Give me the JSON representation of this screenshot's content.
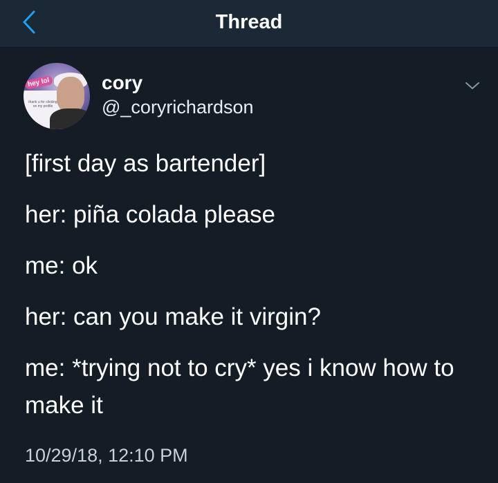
{
  "header": {
    "title": "Thread"
  },
  "tweet": {
    "author_name": "cory",
    "author_handle": "@_coryrichardson",
    "avatar_sticker": "hey lol",
    "avatar_card_text": "thank u for clicking on my profile",
    "lines": [
      "[first day as bartender]",
      "her: piña colada please",
      "me: ok",
      "her: can you make it virgin?",
      "me: *trying not to cry* yes i know how to make it"
    ],
    "timestamp": "10/29/18, 12:10 PM"
  },
  "colors": {
    "background": "#141d26",
    "header_background": "#1b2836",
    "accent": "#1da1f2"
  },
  "icons": {
    "back": "chevron-left-icon",
    "menu": "chevron-down-icon"
  }
}
